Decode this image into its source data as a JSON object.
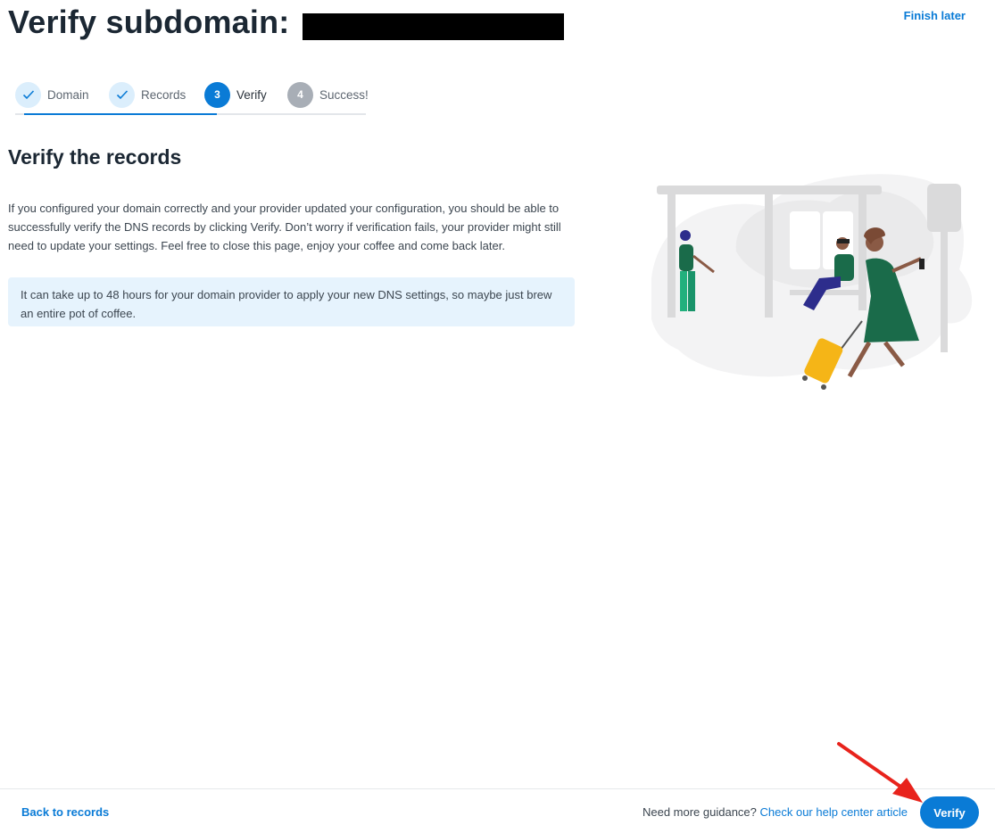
{
  "header": {
    "title": "Verify subdomain:",
    "finish_later": "Finish later"
  },
  "stepper": {
    "steps": [
      {
        "number": "1",
        "label": "Domain",
        "state": "done"
      },
      {
        "number": "2",
        "label": "Records",
        "state": "done"
      },
      {
        "number": "3",
        "label": "Verify",
        "state": "active"
      },
      {
        "number": "4",
        "label": "Success!",
        "state": "pending"
      }
    ],
    "done_icon": "checkmark-icon"
  },
  "main": {
    "section_title": "Verify the records",
    "body": "If you configured your domain correctly and your provider updated your configuration, you should be able to successfully verify the DNS records by clicking Verify. Don’t worry if verification fails, your provider might still need to update your settings. Feel free to close this page, enjoy your coffee and come back later.",
    "info": "It can take up to 48 hours for your domain provider to apply your new DNS settings, so maybe just brew an entire pot of coffee."
  },
  "footer": {
    "back_label": "Back to records",
    "guidance_text": "Need more guidance?",
    "help_link": "Check our help center article",
    "verify_label": "Verify"
  },
  "colors": {
    "accent": "#0a7bd6",
    "info_background": "#e6f3fd",
    "annotation": "#e8231c"
  }
}
